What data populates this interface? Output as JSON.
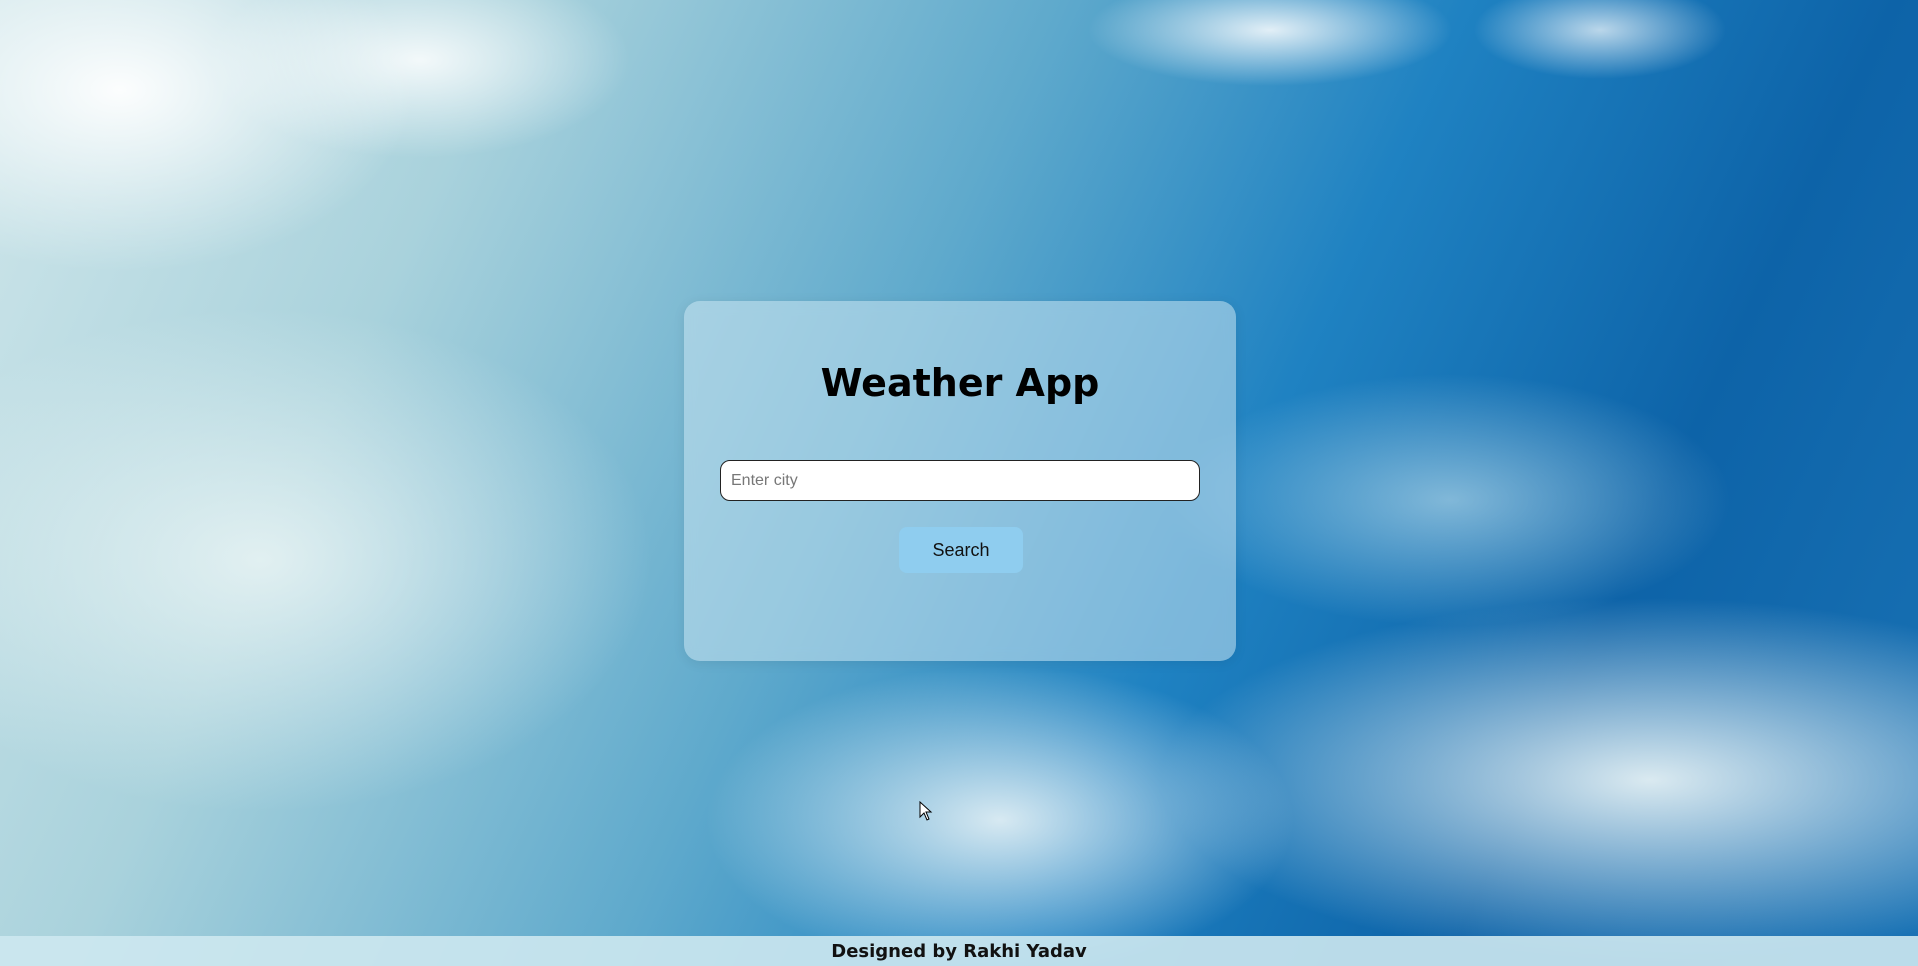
{
  "app": {
    "title": "Weather App"
  },
  "search": {
    "placeholder": "Enter city",
    "value": "",
    "button_label": "Search"
  },
  "footer": {
    "text": "Designed by Rakhi Yadav"
  },
  "colors": {
    "button_bg": "#8fcdef",
    "card_bg": "rgba(200,228,240,0.55)",
    "sky_primary": "#1f82c2"
  },
  "icons": {
    "cursor": "mouse-pointer-icon"
  }
}
